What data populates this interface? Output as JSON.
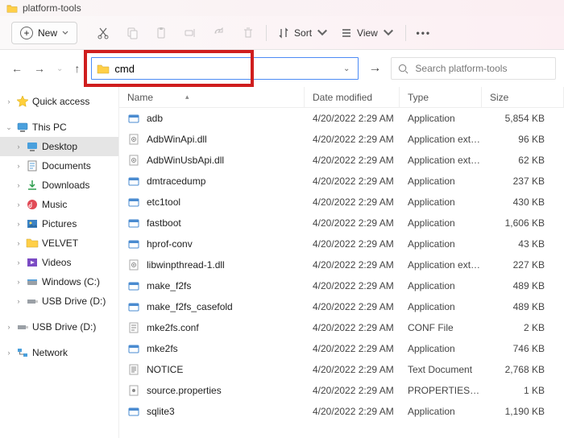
{
  "window": {
    "title": "platform-tools"
  },
  "toolbar": {
    "new_label": "New",
    "sort_label": "Sort",
    "view_label": "View"
  },
  "nav": {
    "address_value": "cmd",
    "search_placeholder": "Search platform-tools"
  },
  "sidebar": {
    "quick_access": "Quick access",
    "this_pc": "This PC",
    "items": [
      {
        "label": "Desktop"
      },
      {
        "label": "Documents"
      },
      {
        "label": "Downloads"
      },
      {
        "label": "Music"
      },
      {
        "label": "Pictures"
      },
      {
        "label": "VELVET"
      },
      {
        "label": "Videos"
      },
      {
        "label": "Windows (C:)"
      },
      {
        "label": "USB Drive (D:)"
      }
    ],
    "usb_root": "USB Drive (D:)",
    "network": "Network"
  },
  "columns": {
    "name": "Name",
    "date": "Date modified",
    "type": "Type",
    "size": "Size"
  },
  "files": [
    {
      "icon": "exe",
      "name": "adb",
      "date": "4/20/2022 2:29 AM",
      "type": "Application",
      "size": "5,854 KB"
    },
    {
      "icon": "dll",
      "name": "AdbWinApi.dll",
      "date": "4/20/2022 2:29 AM",
      "type": "Application exten...",
      "size": "96 KB"
    },
    {
      "icon": "dll",
      "name": "AdbWinUsbApi.dll",
      "date": "4/20/2022 2:29 AM",
      "type": "Application exten...",
      "size": "62 KB"
    },
    {
      "icon": "exe",
      "name": "dmtracedump",
      "date": "4/20/2022 2:29 AM",
      "type": "Application",
      "size": "237 KB"
    },
    {
      "icon": "exe",
      "name": "etc1tool",
      "date": "4/20/2022 2:29 AM",
      "type": "Application",
      "size": "430 KB"
    },
    {
      "icon": "exe",
      "name": "fastboot",
      "date": "4/20/2022 2:29 AM",
      "type": "Application",
      "size": "1,606 KB"
    },
    {
      "icon": "exe",
      "name": "hprof-conv",
      "date": "4/20/2022 2:29 AM",
      "type": "Application",
      "size": "43 KB"
    },
    {
      "icon": "dll",
      "name": "libwinpthread-1.dll",
      "date": "4/20/2022 2:29 AM",
      "type": "Application exten...",
      "size": "227 KB"
    },
    {
      "icon": "exe",
      "name": "make_f2fs",
      "date": "4/20/2022 2:29 AM",
      "type": "Application",
      "size": "489 KB"
    },
    {
      "icon": "exe",
      "name": "make_f2fs_casefold",
      "date": "4/20/2022 2:29 AM",
      "type": "Application",
      "size": "489 KB"
    },
    {
      "icon": "conf",
      "name": "mke2fs.conf",
      "date": "4/20/2022 2:29 AM",
      "type": "CONF File",
      "size": "2 KB"
    },
    {
      "icon": "exe",
      "name": "mke2fs",
      "date": "4/20/2022 2:29 AM",
      "type": "Application",
      "size": "746 KB"
    },
    {
      "icon": "txt",
      "name": "NOTICE",
      "date": "4/20/2022 2:29 AM",
      "type": "Text Document",
      "size": "2,768 KB"
    },
    {
      "icon": "prop",
      "name": "source.properties",
      "date": "4/20/2022 2:29 AM",
      "type": "PROPERTIES File",
      "size": "1 KB"
    },
    {
      "icon": "exe",
      "name": "sqlite3",
      "date": "4/20/2022 2:29 AM",
      "type": "Application",
      "size": "1,190 KB"
    }
  ]
}
